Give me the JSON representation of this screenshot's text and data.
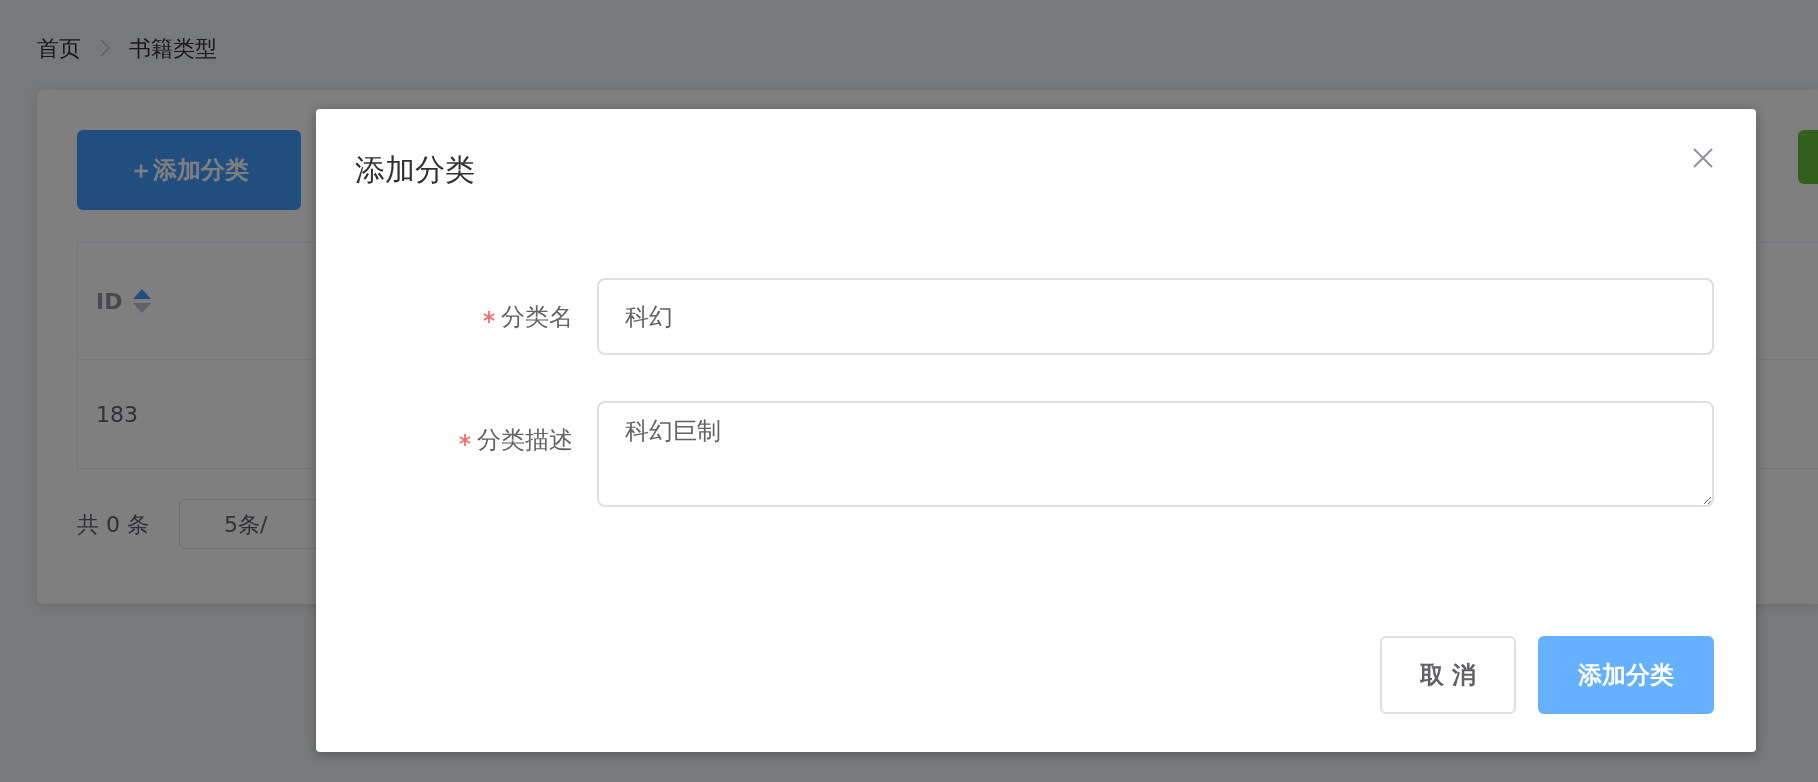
{
  "breadcrumb": [
    {
      "label": "首页"
    },
    {
      "label": "书籍类型"
    }
  ],
  "toolbar": {
    "add_button": "＋添加分类"
  },
  "table": {
    "columns": [
      {
        "label": "ID",
        "sortable": true
      }
    ],
    "rows": [
      [
        "183"
      ]
    ]
  },
  "pagination": {
    "total": "共 0 条",
    "page_size": "5条/"
  },
  "dialog": {
    "title": "添加分类",
    "fields": [
      {
        "label": "分类名",
        "required": true,
        "kind": "input",
        "value": "科幻"
      },
      {
        "label": "分类描述",
        "required": true,
        "kind": "textarea",
        "value": "科幻巨制"
      }
    ],
    "buttons": [
      {
        "label": "取 消",
        "kind": "default"
      },
      {
        "label": "添加分类",
        "kind": "primary"
      }
    ]
  }
}
